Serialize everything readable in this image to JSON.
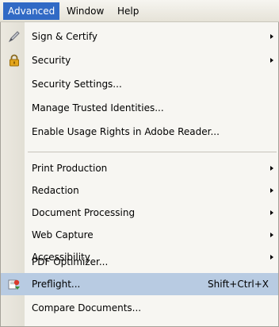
{
  "menubar": {
    "items": [
      {
        "label": "Advanced",
        "active": true
      },
      {
        "label": "Window",
        "active": false
      },
      {
        "label": "Help",
        "active": false
      }
    ]
  },
  "dropdown": {
    "items": [
      {
        "label": "Sign & Certify",
        "submenu": true,
        "icon": "pen-icon"
      },
      {
        "label": "Security",
        "submenu": true,
        "icon": "lock-icon"
      },
      {
        "label": "Security Settings...",
        "submenu": false
      },
      {
        "label": "Manage Trusted Identities...",
        "submenu": false
      },
      {
        "label": "Enable Usage Rights in Adobe Reader...",
        "submenu": false
      },
      {
        "label": "Print Production",
        "submenu": true
      },
      {
        "label": "Redaction",
        "submenu": true
      },
      {
        "label": "Document Processing",
        "submenu": true
      },
      {
        "label": "Web Capture",
        "submenu": true
      },
      {
        "label": "Accessibility",
        "submenu": true
      },
      {
        "label": "PDF Optimizer...",
        "submenu": false
      },
      {
        "label": "Preflight...",
        "submenu": false,
        "shortcut": "Shift+Ctrl+X",
        "icon": "preflight-icon",
        "highlighted": true
      },
      {
        "label": "Compare Documents...",
        "submenu": false
      }
    ]
  },
  "colors": {
    "menu_active": "#316ac5",
    "item_highlight": "#b8cbe2"
  }
}
